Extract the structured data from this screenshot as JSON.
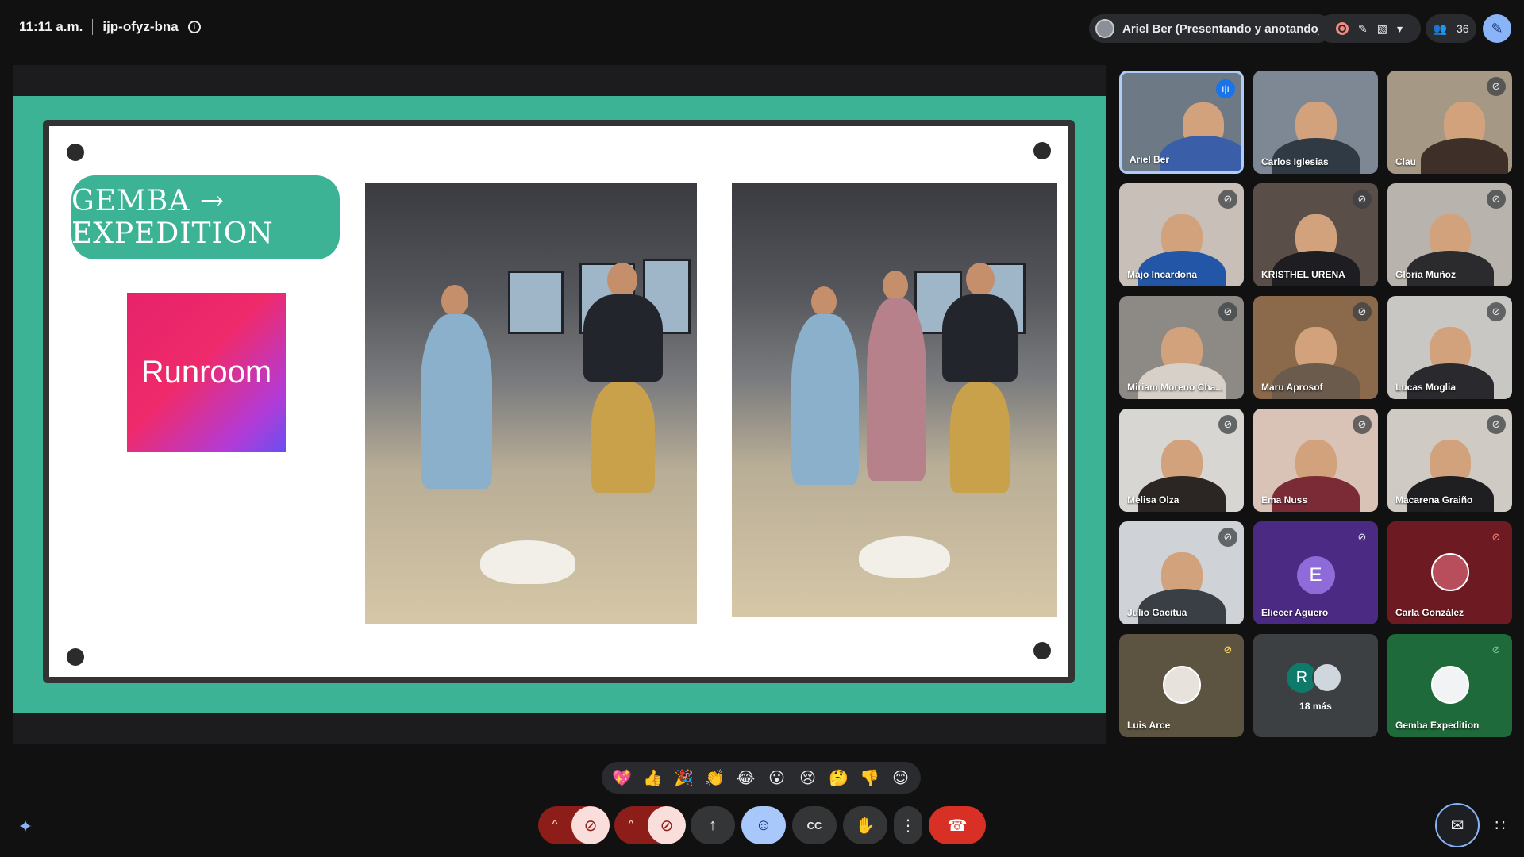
{
  "topbar": {
    "time": "11:11 a.m.",
    "meeting_code": "ijp-ofyz-bna",
    "presenter": "Ariel Ber (Presentando y anotando)",
    "participant_count": "36"
  },
  "slide": {
    "label": "GEMBA → EXPEDITION",
    "logo_text": "Runroom"
  },
  "participants": [
    {
      "name": "Ariel Ber",
      "muted": false,
      "speaking": true
    },
    {
      "name": "Carlos Iglesias",
      "muted": false
    },
    {
      "name": "Clau",
      "muted": true
    },
    {
      "name": "Majo Incardona",
      "muted": true
    },
    {
      "name": "KRISTHEL URENA",
      "muted": true
    },
    {
      "name": "Gloria Muñoz",
      "muted": true
    },
    {
      "name": "Miriam Moreno Cha...",
      "muted": true
    },
    {
      "name": "Maru Aprosof",
      "muted": true
    },
    {
      "name": "Lucas Moglia",
      "muted": true
    },
    {
      "name": "Melisa Olza",
      "muted": true
    },
    {
      "name": "Ema Nuss",
      "muted": true
    },
    {
      "name": "Macarena Graiño",
      "muted": true
    },
    {
      "name": "Julio Gacitua",
      "muted": true
    },
    {
      "name": "Eliecer Aguero",
      "muted": true,
      "initial": "E"
    },
    {
      "name": "Carla González",
      "muted": true
    },
    {
      "name": "Luis Arce",
      "muted": true
    },
    {
      "name": "18 más",
      "initial": "R"
    },
    {
      "name": "Gemba Expedition",
      "muted": true
    }
  ],
  "reactions": [
    "💖",
    "👍",
    "🎉",
    "👏",
    "😂",
    "😮",
    "😢",
    "🤔",
    "👎",
    "😊"
  ],
  "icons": {
    "info": "i",
    "mic_off": "🎙",
    "cam_off": "⊘",
    "present": "↑",
    "emoji": "☺",
    "captions": "CC",
    "hand": "✋",
    "more": "⋮",
    "hangup": "☎",
    "chat": "✉",
    "apps": "∷",
    "gemini": "✦",
    "caret": "^"
  },
  "colors": {
    "slide_bg": "#3bb394",
    "mute_red": "#8c1d18",
    "hangup_red": "#d93025",
    "accent_blue": "#8ab4f8"
  }
}
